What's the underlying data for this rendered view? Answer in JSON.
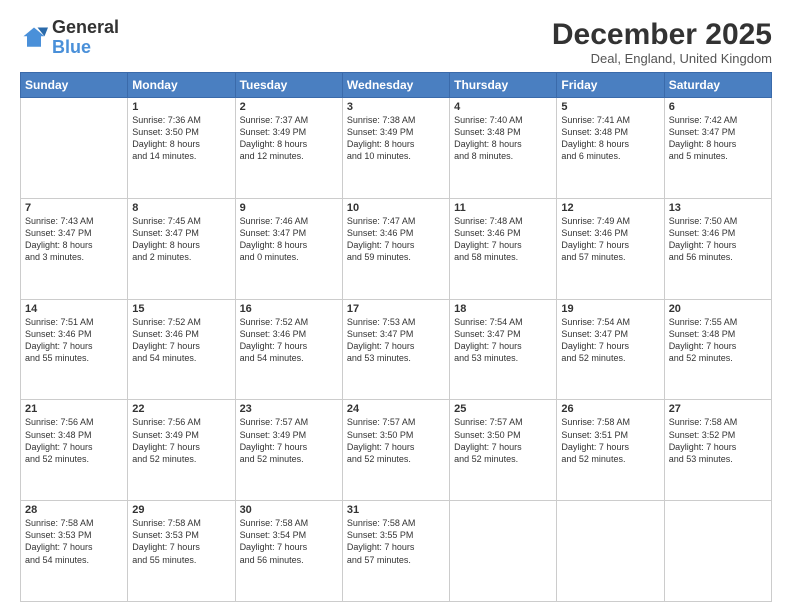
{
  "header": {
    "logo_general": "General",
    "logo_blue": "Blue",
    "month_title": "December 2025",
    "location": "Deal, England, United Kingdom"
  },
  "weekdays": [
    "Sunday",
    "Monday",
    "Tuesday",
    "Wednesday",
    "Thursday",
    "Friday",
    "Saturday"
  ],
  "weeks": [
    [
      {
        "day": "",
        "info": ""
      },
      {
        "day": "1",
        "info": "Sunrise: 7:36 AM\nSunset: 3:50 PM\nDaylight: 8 hours\nand 14 minutes."
      },
      {
        "day": "2",
        "info": "Sunrise: 7:37 AM\nSunset: 3:49 PM\nDaylight: 8 hours\nand 12 minutes."
      },
      {
        "day": "3",
        "info": "Sunrise: 7:38 AM\nSunset: 3:49 PM\nDaylight: 8 hours\nand 10 minutes."
      },
      {
        "day": "4",
        "info": "Sunrise: 7:40 AM\nSunset: 3:48 PM\nDaylight: 8 hours\nand 8 minutes."
      },
      {
        "day": "5",
        "info": "Sunrise: 7:41 AM\nSunset: 3:48 PM\nDaylight: 8 hours\nand 6 minutes."
      },
      {
        "day": "6",
        "info": "Sunrise: 7:42 AM\nSunset: 3:47 PM\nDaylight: 8 hours\nand 5 minutes."
      }
    ],
    [
      {
        "day": "7",
        "info": "Sunrise: 7:43 AM\nSunset: 3:47 PM\nDaylight: 8 hours\nand 3 minutes."
      },
      {
        "day": "8",
        "info": "Sunrise: 7:45 AM\nSunset: 3:47 PM\nDaylight: 8 hours\nand 2 minutes."
      },
      {
        "day": "9",
        "info": "Sunrise: 7:46 AM\nSunset: 3:47 PM\nDaylight: 8 hours\nand 0 minutes."
      },
      {
        "day": "10",
        "info": "Sunrise: 7:47 AM\nSunset: 3:46 PM\nDaylight: 7 hours\nand 59 minutes."
      },
      {
        "day": "11",
        "info": "Sunrise: 7:48 AM\nSunset: 3:46 PM\nDaylight: 7 hours\nand 58 minutes."
      },
      {
        "day": "12",
        "info": "Sunrise: 7:49 AM\nSunset: 3:46 PM\nDaylight: 7 hours\nand 57 minutes."
      },
      {
        "day": "13",
        "info": "Sunrise: 7:50 AM\nSunset: 3:46 PM\nDaylight: 7 hours\nand 56 minutes."
      }
    ],
    [
      {
        "day": "14",
        "info": "Sunrise: 7:51 AM\nSunset: 3:46 PM\nDaylight: 7 hours\nand 55 minutes."
      },
      {
        "day": "15",
        "info": "Sunrise: 7:52 AM\nSunset: 3:46 PM\nDaylight: 7 hours\nand 54 minutes."
      },
      {
        "day": "16",
        "info": "Sunrise: 7:52 AM\nSunset: 3:46 PM\nDaylight: 7 hours\nand 54 minutes."
      },
      {
        "day": "17",
        "info": "Sunrise: 7:53 AM\nSunset: 3:47 PM\nDaylight: 7 hours\nand 53 minutes."
      },
      {
        "day": "18",
        "info": "Sunrise: 7:54 AM\nSunset: 3:47 PM\nDaylight: 7 hours\nand 53 minutes."
      },
      {
        "day": "19",
        "info": "Sunrise: 7:54 AM\nSunset: 3:47 PM\nDaylight: 7 hours\nand 52 minutes."
      },
      {
        "day": "20",
        "info": "Sunrise: 7:55 AM\nSunset: 3:48 PM\nDaylight: 7 hours\nand 52 minutes."
      }
    ],
    [
      {
        "day": "21",
        "info": "Sunrise: 7:56 AM\nSunset: 3:48 PM\nDaylight: 7 hours\nand 52 minutes."
      },
      {
        "day": "22",
        "info": "Sunrise: 7:56 AM\nSunset: 3:49 PM\nDaylight: 7 hours\nand 52 minutes."
      },
      {
        "day": "23",
        "info": "Sunrise: 7:57 AM\nSunset: 3:49 PM\nDaylight: 7 hours\nand 52 minutes."
      },
      {
        "day": "24",
        "info": "Sunrise: 7:57 AM\nSunset: 3:50 PM\nDaylight: 7 hours\nand 52 minutes."
      },
      {
        "day": "25",
        "info": "Sunrise: 7:57 AM\nSunset: 3:50 PM\nDaylight: 7 hours\nand 52 minutes."
      },
      {
        "day": "26",
        "info": "Sunrise: 7:58 AM\nSunset: 3:51 PM\nDaylight: 7 hours\nand 52 minutes."
      },
      {
        "day": "27",
        "info": "Sunrise: 7:58 AM\nSunset: 3:52 PM\nDaylight: 7 hours\nand 53 minutes."
      }
    ],
    [
      {
        "day": "28",
        "info": "Sunrise: 7:58 AM\nSunset: 3:53 PM\nDaylight: 7 hours\nand 54 minutes."
      },
      {
        "day": "29",
        "info": "Sunrise: 7:58 AM\nSunset: 3:53 PM\nDaylight: 7 hours\nand 55 minutes."
      },
      {
        "day": "30",
        "info": "Sunrise: 7:58 AM\nSunset: 3:54 PM\nDaylight: 7 hours\nand 56 minutes."
      },
      {
        "day": "31",
        "info": "Sunrise: 7:58 AM\nSunset: 3:55 PM\nDaylight: 7 hours\nand 57 minutes."
      },
      {
        "day": "",
        "info": ""
      },
      {
        "day": "",
        "info": ""
      },
      {
        "day": "",
        "info": ""
      }
    ]
  ]
}
